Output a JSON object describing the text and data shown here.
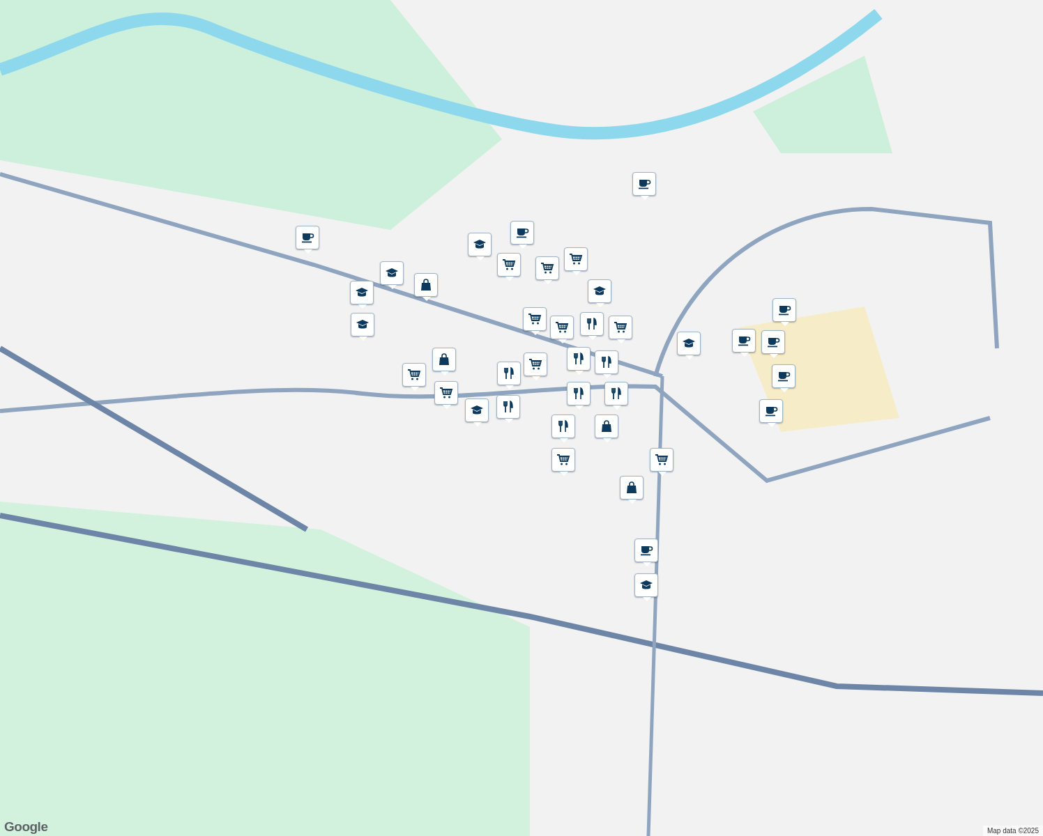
{
  "markers": [
    {
      "kind": "cafe"
    },
    {
      "kind": "cafe"
    },
    {
      "kind": "school"
    },
    {
      "kind": "cafe"
    },
    {
      "kind": "cart"
    },
    {
      "kind": "school"
    },
    {
      "kind": "cart"
    },
    {
      "kind": "cart"
    },
    {
      "kind": "bag"
    },
    {
      "kind": "school"
    },
    {
      "kind": "school"
    },
    {
      "kind": "school"
    },
    {
      "kind": "restaurant"
    },
    {
      "kind": "cart"
    },
    {
      "kind": "cart"
    },
    {
      "kind": "cafe"
    },
    {
      "kind": "restaurant"
    },
    {
      "kind": "cart"
    },
    {
      "kind": "cafe"
    },
    {
      "kind": "cafe"
    },
    {
      "kind": "school"
    },
    {
      "kind": "restaurant"
    },
    {
      "kind": "bag"
    },
    {
      "kind": "cart"
    },
    {
      "kind": "cafe"
    },
    {
      "kind": "restaurant"
    },
    {
      "kind": "cart"
    },
    {
      "kind": "cart"
    },
    {
      "kind": "restaurant"
    },
    {
      "kind": "restaurant"
    },
    {
      "kind": "cafe"
    },
    {
      "kind": "restaurant"
    },
    {
      "kind": "school"
    },
    {
      "kind": "bag"
    },
    {
      "kind": "restaurant"
    },
    {
      "kind": "cart"
    },
    {
      "kind": "cart"
    },
    {
      "kind": "bag"
    },
    {
      "kind": "cafe"
    },
    {
      "kind": "school"
    }
  ],
  "attribution": {
    "logo": "Google",
    "map_data": "Map data ©2025"
  }
}
